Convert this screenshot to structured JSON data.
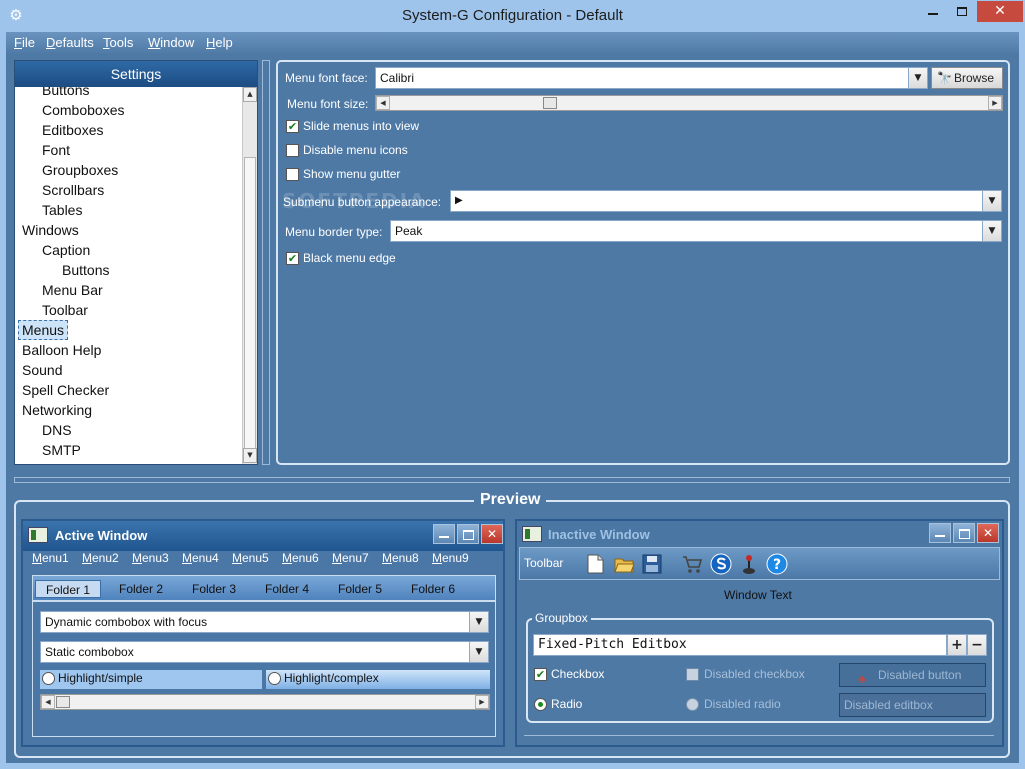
{
  "window": {
    "title": "System-G Configuration - Default",
    "app_icon": "gear-icon"
  },
  "menubar": [
    "File",
    "Defaults",
    "Tools",
    "Window",
    "Help"
  ],
  "settings_tree": {
    "header": "Settings",
    "items": [
      {
        "label": "Buttons",
        "level": 1
      },
      {
        "label": "Comboboxes",
        "level": 1
      },
      {
        "label": "Editboxes",
        "level": 1
      },
      {
        "label": "Font",
        "level": 1
      },
      {
        "label": "Groupboxes",
        "level": 1
      },
      {
        "label": "Scrollbars",
        "level": 1
      },
      {
        "label": "Tables",
        "level": 1
      },
      {
        "label": "Windows",
        "level": 0
      },
      {
        "label": "Caption",
        "level": 1
      },
      {
        "label": "Buttons",
        "level": 2
      },
      {
        "label": "Menu Bar",
        "level": 1
      },
      {
        "label": "Toolbar",
        "level": 1
      },
      {
        "label": "Menus",
        "level": 0,
        "selected": true
      },
      {
        "label": "Balloon Help",
        "level": 0
      },
      {
        "label": "Sound",
        "level": 0
      },
      {
        "label": "Spell Checker",
        "level": 0
      },
      {
        "label": "Networking",
        "level": 0
      },
      {
        "label": "DNS",
        "level": 1
      },
      {
        "label": "SMTP",
        "level": 1
      }
    ]
  },
  "menus_panel": {
    "font_face_label": "Menu font face:",
    "font_face_value": "Calibri",
    "browse_label": "Browse",
    "font_size_label": "Menu font size:",
    "font_size_fraction": 0.26,
    "slide_menus_label": "Slide menus into view",
    "slide_menus_checked": true,
    "disable_icons_label": "Disable menu icons",
    "disable_icons_checked": false,
    "show_gutter_label": "Show menu gutter",
    "show_gutter_checked": false,
    "submenu_label": "Submenu button appearance:",
    "submenu_value": "▶",
    "border_type_label": "Menu border type:",
    "border_type_value": "Peak",
    "black_edge_label": "Black menu edge",
    "black_edge_checked": true,
    "watermark": "SOFTPEDIA"
  },
  "preview": {
    "title": "Preview",
    "active_window": {
      "title": "Active Window",
      "menus": [
        "Menu1",
        "Menu2",
        "Menu3",
        "Menu4",
        "Menu5",
        "Menu6",
        "Menu7",
        "Menu8",
        "Menu9"
      ],
      "tabs": [
        "Folder 1",
        "Folder 2",
        "Folder 3",
        "Folder 4",
        "Folder 5",
        "Folder 6"
      ],
      "combo_focus": "Dynamic combobox with focus",
      "combo_static": "Static combobox",
      "highlight_simple": "Highlight/simple",
      "highlight_complex": "Highlight/complex"
    },
    "inactive_window": {
      "title": "Inactive Window",
      "toolbar_label": "Toolbar",
      "toolbar_icons": [
        "new-document-icon",
        "open-folder-icon",
        "save-icon",
        "cart-icon",
        "s-logo-icon",
        "joystick-icon",
        "help-icon"
      ],
      "window_text": "Window Text",
      "groupbox_title": "Groupbox",
      "fixed_pitch_editbox": "Fixed-Pitch Editbox",
      "checkbox_label": "Checkbox",
      "checkbox_checked": true,
      "disabled_checkbox_label": "Disabled checkbox",
      "disabled_button_label": "Disabled button",
      "radio_label": "Radio",
      "disabled_radio_label": "Disabled radio",
      "disabled_editbox_label": "Disabled editbox"
    }
  },
  "colors": {
    "frame": "#4e79a5",
    "titlebar": "#9ec4ec",
    "tree_header": "#1c4c82",
    "close_red": "#c74a3e"
  }
}
